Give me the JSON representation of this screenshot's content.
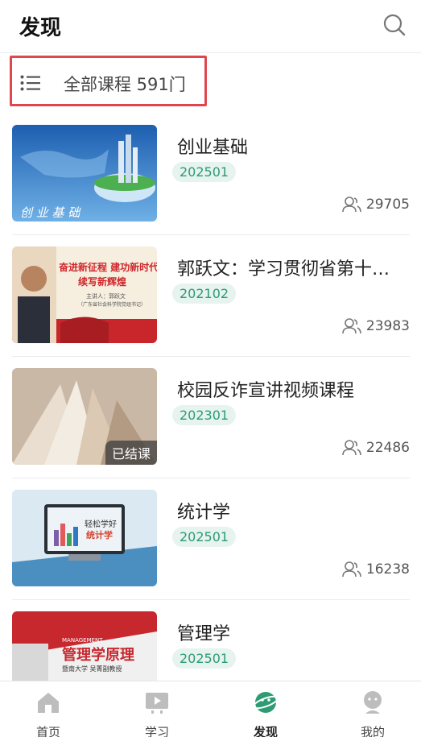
{
  "header": {
    "title": "发现",
    "search_icon": "search-icon"
  },
  "filter": {
    "label": "全部课程 591门",
    "icon": "list-icon"
  },
  "courses": [
    {
      "name": "创业基础",
      "term": "202501",
      "count": "29705",
      "thumb_caption": "创 业 基 础"
    },
    {
      "name": "郭跃文：学习贯彻省第十…",
      "term": "202102",
      "count": "23983",
      "thumb_line1": "奋进新征程 建功新时代",
      "thumb_line2": "续写新辉煌",
      "thumb_sub": "主讲人：郭跃文",
      "thumb_sub2": "（广东省社会科学院党组书记）"
    },
    {
      "name": "校园反诈宣讲视频课程",
      "term": "202301",
      "count": "22486",
      "overlay": "已结课"
    },
    {
      "name": "统计学",
      "term": "202501",
      "count": "16238",
      "thumb_text1": "轻松学好",
      "thumb_text2": "统计学"
    },
    {
      "name": "管理学",
      "term": "202501",
      "count": "",
      "thumb_en": "MANAGEMENT",
      "thumb_title": "管理学原理",
      "thumb_sub": "暨南大学 吴菁副教授"
    }
  ],
  "tabs": [
    {
      "label": "首页",
      "icon": "home-icon"
    },
    {
      "label": "学习",
      "icon": "video-icon"
    },
    {
      "label": "发现",
      "icon": "planet-icon",
      "active": true
    },
    {
      "label": "我的",
      "icon": "profile-icon"
    }
  ],
  "colors": {
    "accent": "#2e9b74",
    "highlight_border": "#e0474d",
    "tag_bg": "#e6f3ee"
  }
}
